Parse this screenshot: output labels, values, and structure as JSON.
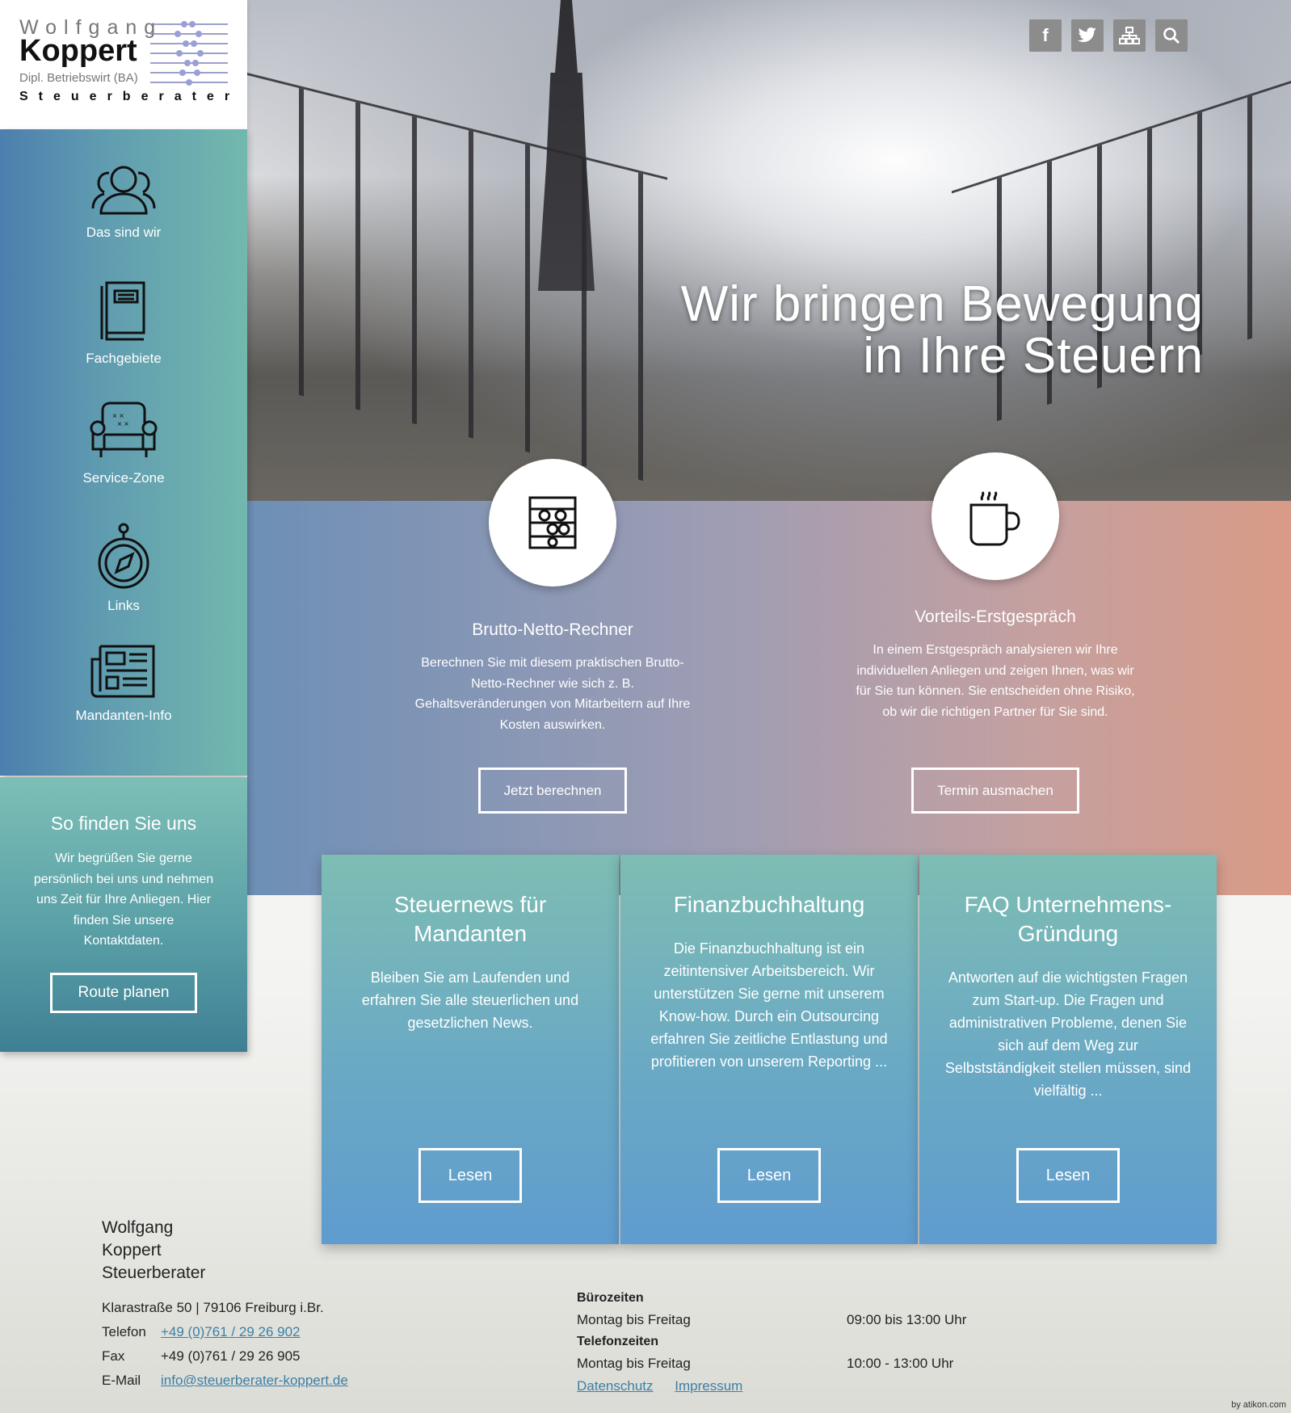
{
  "logo": {
    "line1": "Wolfgang",
    "line2": "Koppert",
    "line3": "Dipl. Betriebswirt (BA)",
    "line4": "Steuerberater"
  },
  "social": [
    {
      "icon": "facebook-icon",
      "glyph": "f"
    },
    {
      "icon": "twitter-icon",
      "glyph": "🐦"
    },
    {
      "icon": "sitemap-icon",
      "glyph": "⌘"
    },
    {
      "icon": "search-icon",
      "glyph": "⌕"
    }
  ],
  "hero": {
    "line1": "Wir bringen Bewegung",
    "line2": "in Ihre Steuern"
  },
  "nav": [
    {
      "label": "Das sind wir",
      "icon": "team-icon"
    },
    {
      "label": "Fachgebiete",
      "icon": "book-icon"
    },
    {
      "label": "Service-Zone",
      "icon": "armchair-icon"
    },
    {
      "label": "Links",
      "icon": "compass-icon"
    },
    {
      "label": "Mandanten-Info",
      "icon": "newspaper-icon"
    }
  ],
  "findus": {
    "title": "So finden Sie uns",
    "text": "Wir begrüßen Sie gerne persönlich bei uns und nehmen uns Zeit für Ihre Anliegen. Hier finden Sie unsere Kontaktdaten.",
    "button": "Route planen"
  },
  "services": [
    {
      "icon": "abacus-icon",
      "title": "Brutto-Netto-Rechner",
      "text": "Berechnen Sie mit diesem praktischen Brutto-Netto-Rechner wie sich z. B. Gehaltsveränderungen von Mitarbeitern auf Ihre Kosten auswirken.",
      "button": "Jetzt berechnen"
    },
    {
      "icon": "coffee-cup-icon",
      "title": "Vorteils-Erstgespräch",
      "text": "In einem Erstgespräch analysieren wir Ihre individuellen Anliegen und zeigen Ihnen, was wir für Sie tun können. Sie entscheiden ohne Risiko, ob wir die richtigen Partner für Sie sind.",
      "button": "Termin ausmachen"
    }
  ],
  "cards": [
    {
      "title": "Steuernews für Mandanten",
      "text": "Bleiben Sie am Laufenden und erfahren Sie alle steuerlichen und gesetzlichen News.",
      "button": "Lesen"
    },
    {
      "title": "Finanzbuchhaltung",
      "text": "Die Finanzbuchhaltung ist ein zeitintensiver Arbeitsbereich. Wir unterstützen Sie gerne mit unserem Know-how. Durch ein Outsourcing erfahren Sie zeitliche Entlastung und profitieren von unserem Reporting ...",
      "button": "Lesen"
    },
    {
      "title": "FAQ Unternehmens-Gründung",
      "text": "Antworten auf die wichtigsten Fragen zum Start-up. Die Fragen und administrativen Probleme, denen Sie sich auf dem Weg zur Selbstständigkeit stellen müssen, sind vielfältig ...",
      "button": "Lesen"
    }
  ],
  "footer": {
    "name": [
      "Wolfgang",
      "Koppert",
      "Steuerberater"
    ],
    "address": "Klarastraße 50 | 79106 Freiburg i.Br.",
    "phone_label": "Telefon",
    "phone": "+49 (0)761 / 29 26 902",
    "fax_label": "Fax",
    "fax": "+49 (0)761 / 29 26 905",
    "email_label": "E-Mail",
    "email": "info@steuerberater-koppert.de",
    "office_hours_title": "Bürozeiten",
    "office_days": "Montag bis Freitag",
    "office_time": "09:00 bis 13:00 Uhr",
    "phone_hours_title": "Telefonzeiten",
    "phone_days": "Montag bis Freitag",
    "phone_time": "10:00 - 13:00 Uhr",
    "privacy": "Datenschutz",
    "imprint": "Impressum"
  },
  "credit": "by atikon.com"
}
